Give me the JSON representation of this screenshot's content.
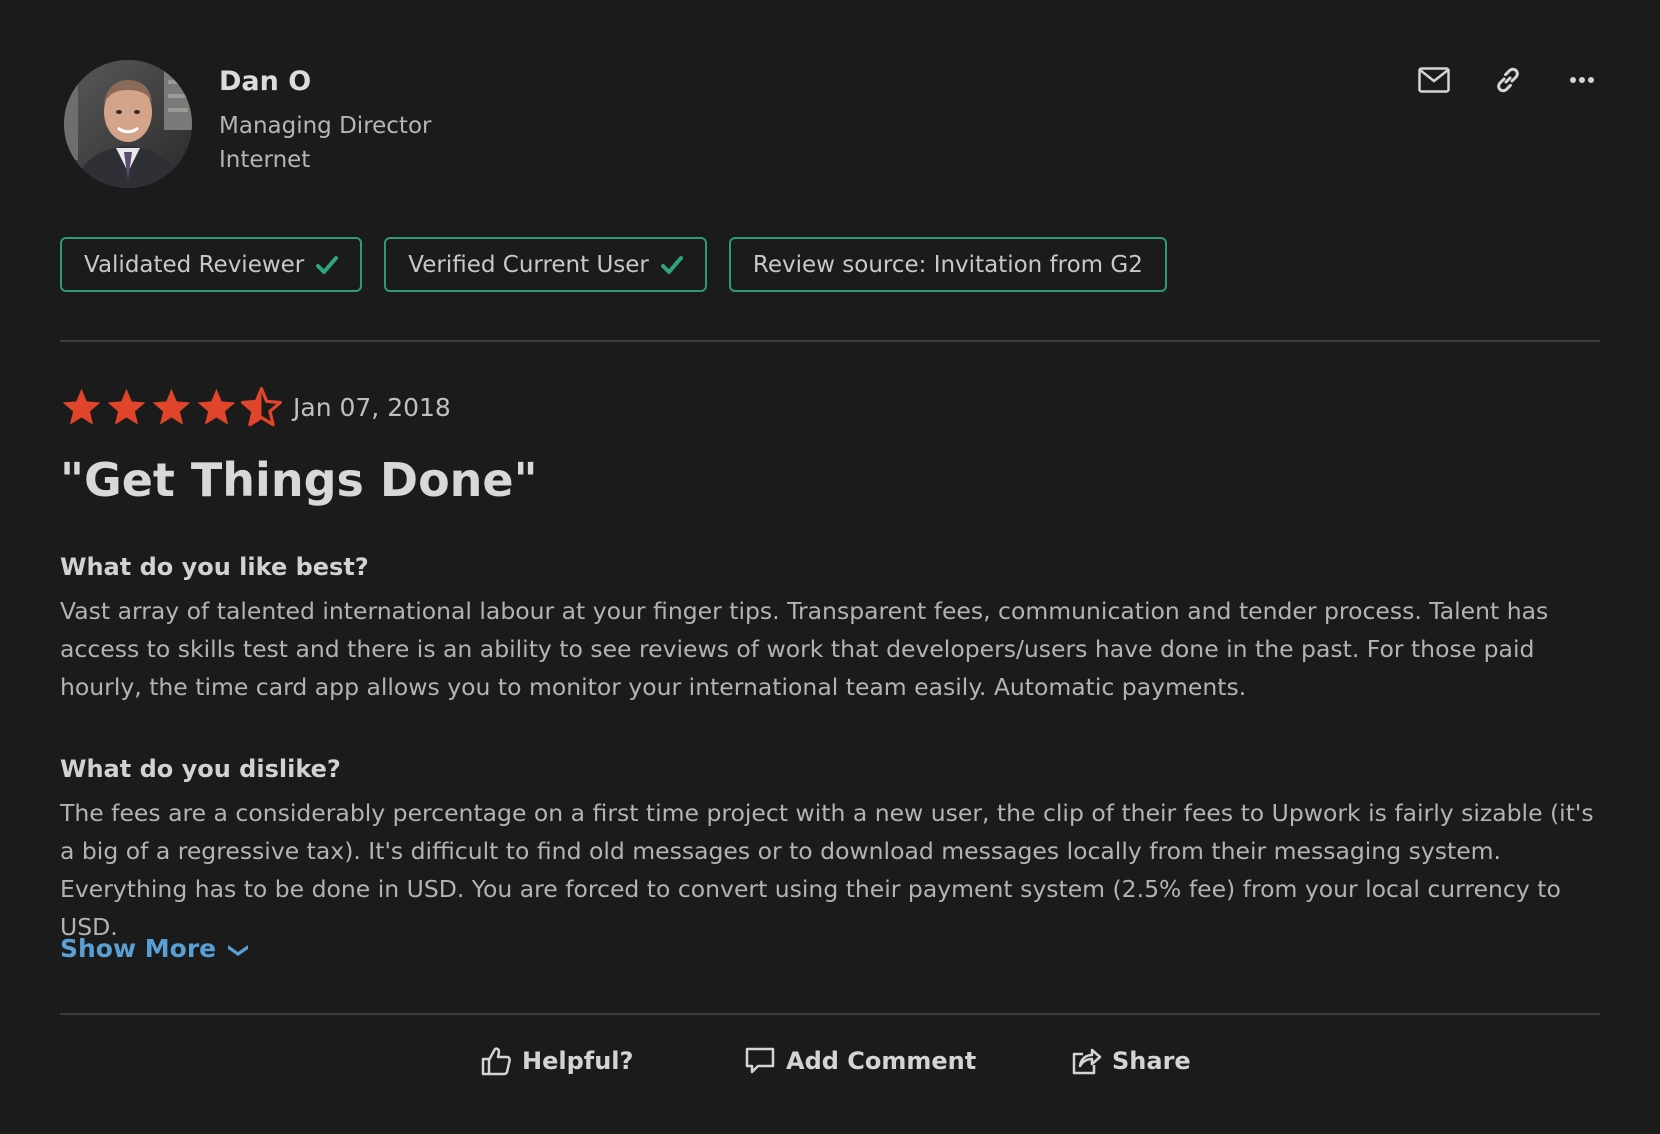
{
  "reviewer": {
    "name": "Dan O",
    "title": "Managing Director",
    "company": "Internet"
  },
  "header_actions": {
    "icons": [
      "mail-icon",
      "link-icon",
      "more-icon"
    ]
  },
  "badges": [
    {
      "label": "Validated Reviewer",
      "checked": true
    },
    {
      "label": "Verified Current User",
      "checked": true
    },
    {
      "label": "Review source: Invitation from G2",
      "checked": false
    }
  ],
  "review": {
    "rating": 4.5,
    "max_rating": 5,
    "date": "Jan 07, 2018",
    "title": "\"Get Things Done\"",
    "like_heading": "What do you like best?",
    "like_body": "Vast array of talented international labour at your finger tips. Transparent fees, communication and tender process. Talent has access to skills test and there is an ability to see reviews of work that developers/users have done in the past. For those paid hourly, the time card app allows you to monitor your international team easily. Automatic payments.",
    "dislike_heading": "What do you dislike?",
    "dislike_body": "The fees are a considerably percentage on a first time project with a new user, the clip of their fees to Upwork is fairly sizable (it's a big of a regressive tax). It's difficult to find old messages or to download messages locally from their messaging system. Everything has to be done in USD. You are forced to convert using their payment system (2.5% fee) from your local currency to USD.",
    "show_more_label": "Show More"
  },
  "footer": {
    "helpful_label": "Helpful?",
    "comment_label": "Add Comment",
    "share_label": "Share"
  },
  "colors": {
    "background": "#1b1b1b",
    "badge_border": "#2f9b75",
    "check": "#2fa57a",
    "star": "#e0452b",
    "link": "#5a9fd4"
  }
}
